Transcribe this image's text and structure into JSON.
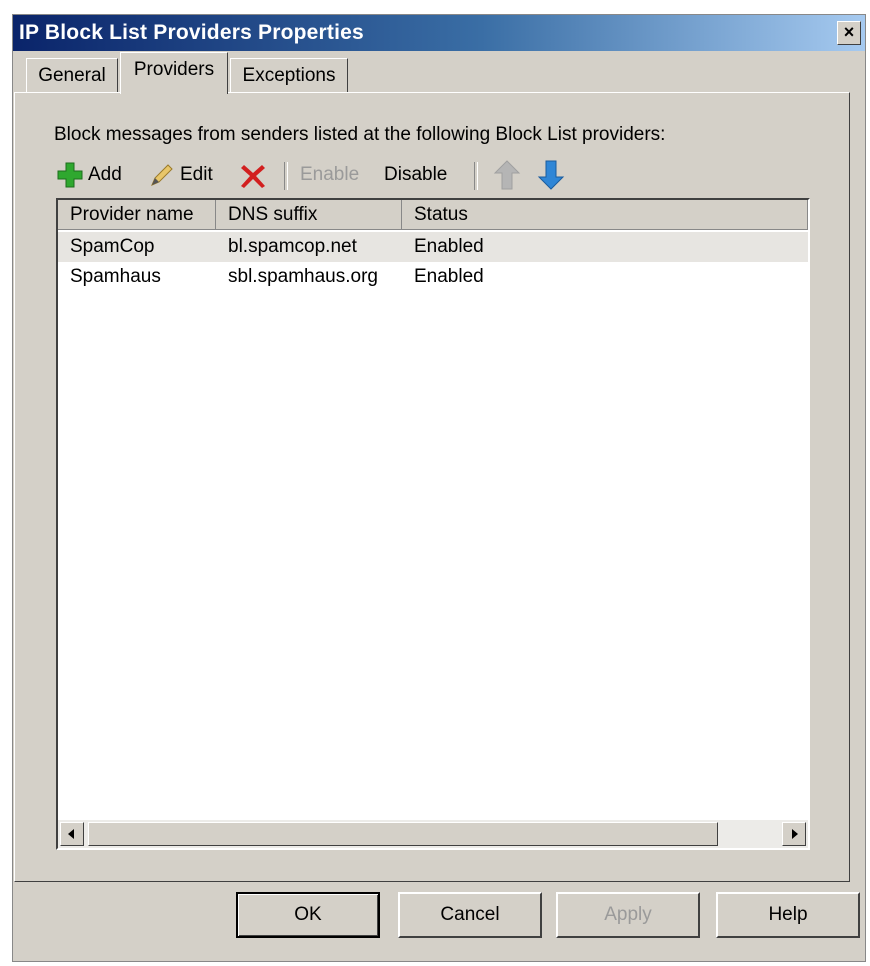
{
  "window": {
    "title": "IP Block List Providers Properties",
    "close_glyph": "×"
  },
  "tabs": [
    {
      "label": "General"
    },
    {
      "label": "Providers"
    },
    {
      "label": "Exceptions"
    }
  ],
  "active_tab": "Providers",
  "description": "Block messages from senders listed at the following Block List providers:",
  "toolbar": {
    "add_label": "Add",
    "edit_label": "Edit",
    "enable_label": "Enable",
    "disable_label": "Disable",
    "icons": [
      "add-icon",
      "edit-icon",
      "delete-icon",
      "move-up-icon",
      "move-down-icon"
    ]
  },
  "table": {
    "columns": [
      "Provider name",
      "DNS suffix",
      "Status"
    ],
    "rows": [
      {
        "name": "SpamCop",
        "dns": "bl.spamcop.net",
        "status": "Enabled"
      },
      {
        "name": "Spamhaus",
        "dns": "sbl.spamhaus.org",
        "status": "Enabled"
      }
    ]
  },
  "buttons": {
    "ok": "OK",
    "cancel": "Cancel",
    "apply": "Apply",
    "help": "Help"
  },
  "colors": {
    "title_gradient_start": "#0a246a",
    "title_gradient_end": "#a6caf0",
    "dialog_bg": "#d4d0c8",
    "disabled_text": "#9a9a9a",
    "add_green": "#2fa82f",
    "delete_red": "#d21f1f",
    "arrow_blue": "#2f86d6"
  }
}
